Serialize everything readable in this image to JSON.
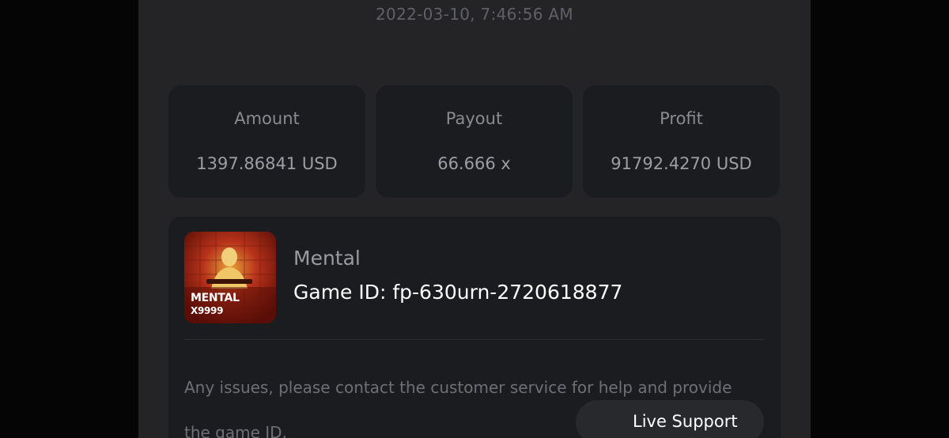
{
  "timestamp": "2022-03-10, 7:46:56 AM",
  "stats": {
    "amount": {
      "label": "Amount",
      "value": "1397.86841 USD"
    },
    "payout": {
      "label": "Payout",
      "value": "66.666 x"
    },
    "profit": {
      "label": "Profit",
      "value": "91792.4270 USD"
    }
  },
  "game": {
    "thumbnail_title": "MENTAL",
    "thumbnail_subtitle": "X9999",
    "name": "Mental",
    "id_text": "Game ID: fp-630urn-2720618877"
  },
  "support": {
    "notice": "Any issues, please contact the customer service for help and provide the game ID.",
    "button_label": "Live Support"
  },
  "colors": {
    "background": "#242427",
    "card": "#1b1c1f",
    "thumbnail_accent": "#c4381c"
  }
}
